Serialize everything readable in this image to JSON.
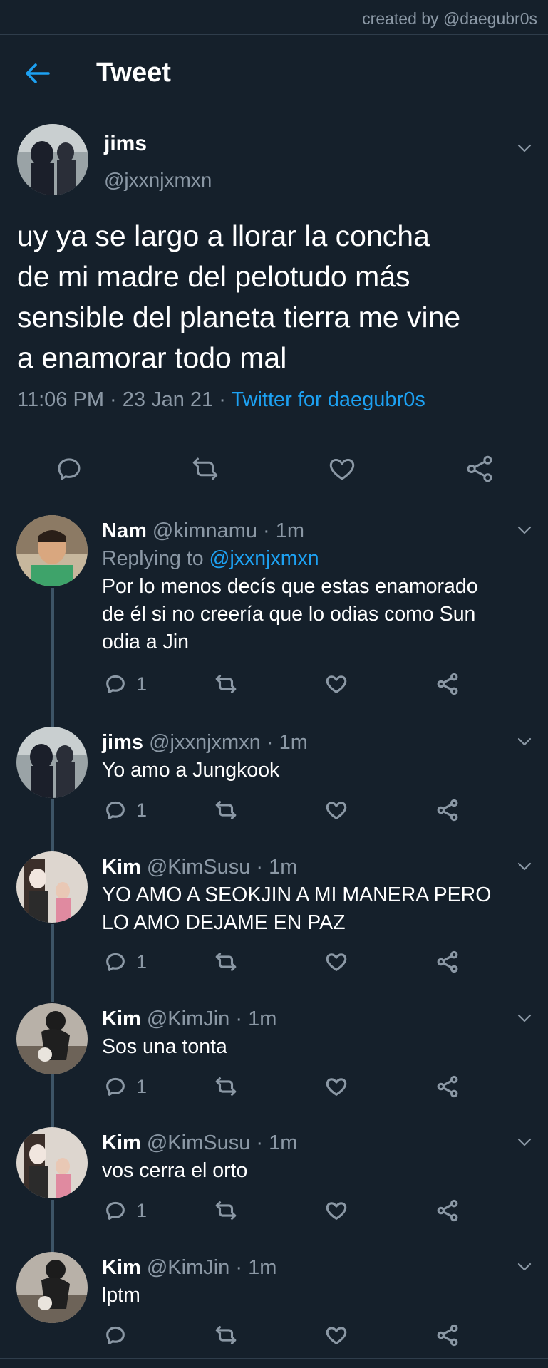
{
  "watermark": "created by @daegubr0s",
  "header": {
    "title": "Tweet"
  },
  "tweet": {
    "name": "jims",
    "handle": "@jxxnjxmxn",
    "text_lines": [
      "uy ya se largo a llorar la concha",
      "de mi madre del pelotudo más",
      "sensible del planeta tierra me vine",
      "a enamorar todo mal"
    ],
    "time": "11:06 PM",
    "date": "23 Jan 21",
    "source": "Twitter for daegubr0s"
  },
  "replies": [
    {
      "name": "Nam",
      "handle": "@kimnamu · 1m",
      "replying_prefix": "Replying to ",
      "replying_to": "@jxxnjxmxn",
      "lines": [
        "Por lo menos decís que estas enamorado",
        "de él si no creería que lo odias como Sun",
        "odia a Jin"
      ],
      "reply_count": "1"
    },
    {
      "name": "jims",
      "handle": "@jxxnjxmxn · 1m",
      "lines": [
        "Yo amo a Jungkook"
      ],
      "reply_count": "1"
    },
    {
      "name": "Kim",
      "handle": "@KimSusu · 1m",
      "lines": [
        "YO AMO A SEOKJIN A MI MANERA PERO",
        "LO AMO DEJAME EN PAZ"
      ],
      "reply_count": "1"
    },
    {
      "name": "Kim",
      "handle": "@KimJin · 1m",
      "lines": [
        "Sos una tonta"
      ],
      "reply_count": "1"
    },
    {
      "name": "Kim",
      "handle": "@KimSusu · 1m",
      "lines": [
        "vos cerra el orto"
      ],
      "reply_count": "1"
    },
    {
      "name": "Kim",
      "handle": "@KimJin · 1m",
      "lines": [
        "lptm"
      ],
      "reply_count": ""
    }
  ],
  "colors": {
    "background": "#15202b",
    "accent": "#1da1f2",
    "muted": "#8b98a5",
    "divider": "#2f3d4b"
  },
  "icons": [
    "back-arrow-icon",
    "chevron-down-icon",
    "reply-icon",
    "retweet-icon",
    "like-icon",
    "share-icon"
  ]
}
